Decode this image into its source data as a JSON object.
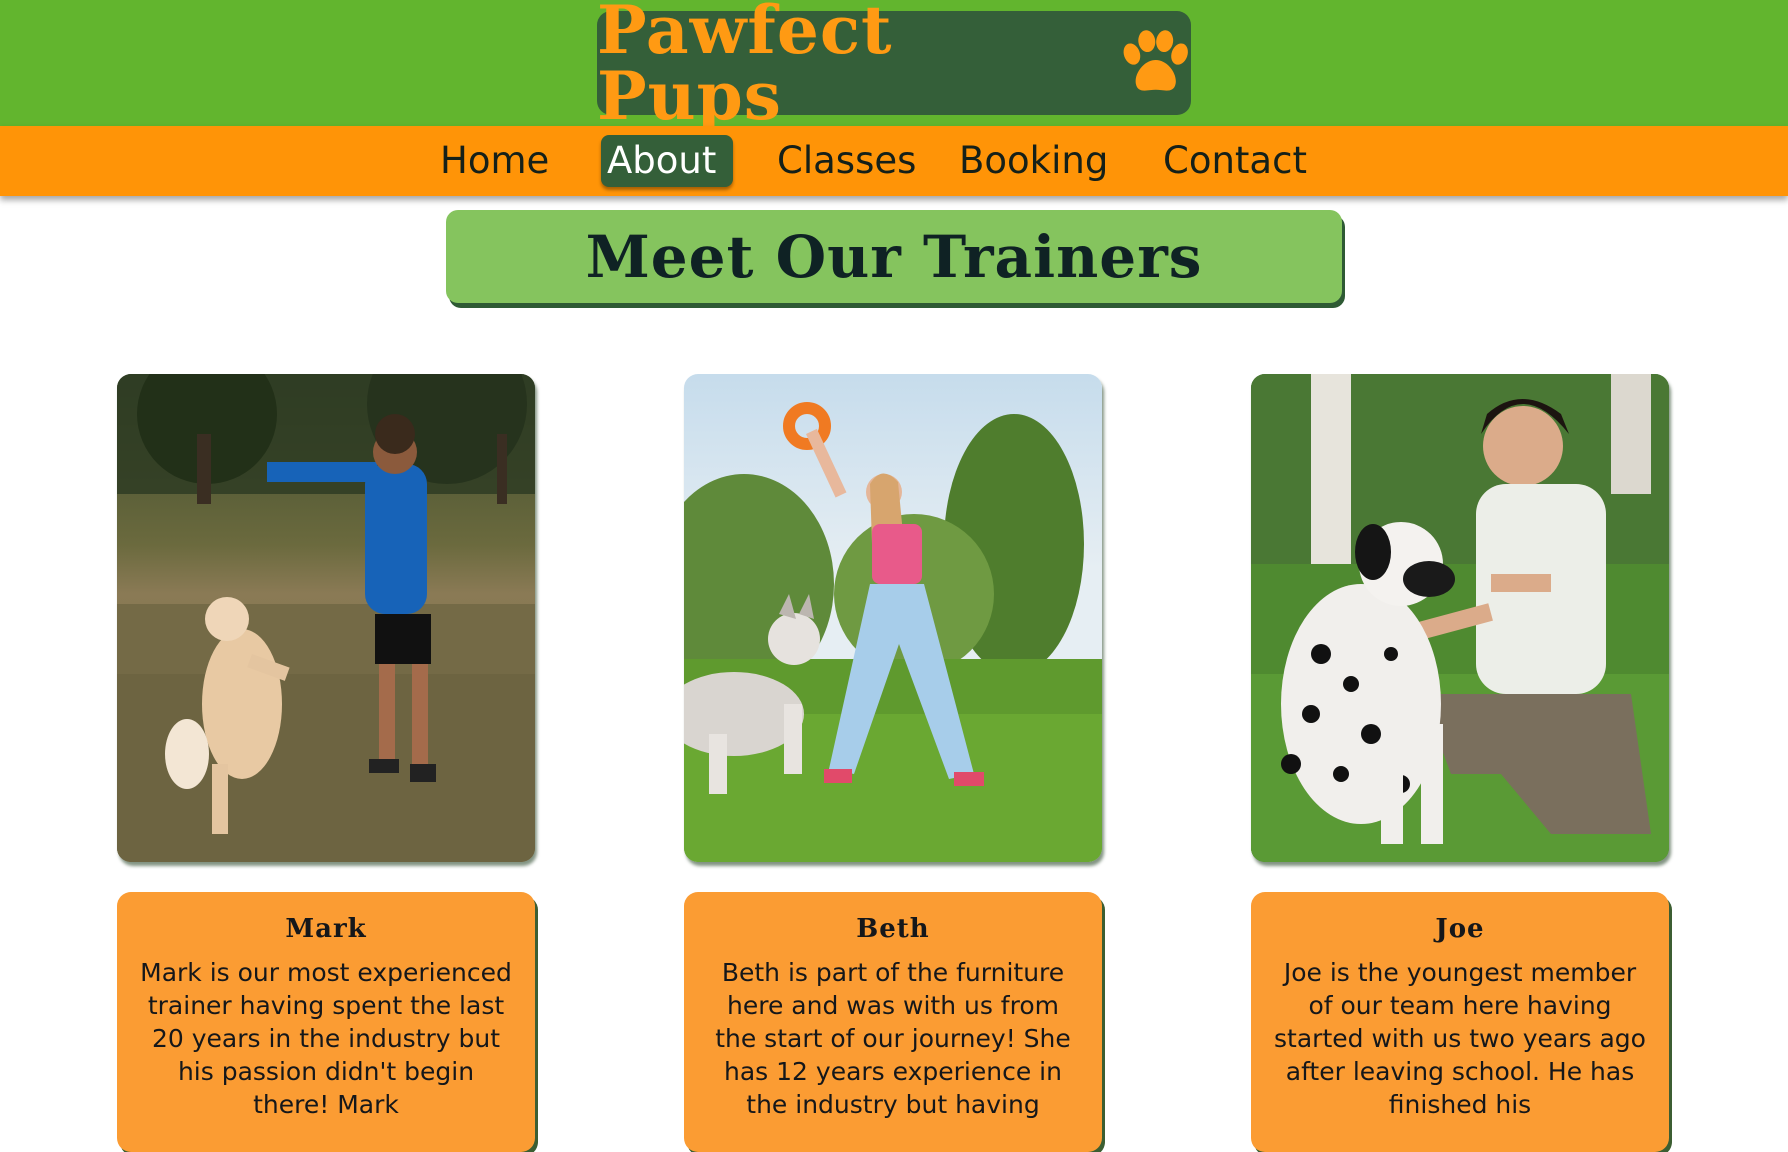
{
  "header": {
    "logo_text": "Pawfect Pups",
    "logo_icon": "paw-icon"
  },
  "nav": {
    "items": [
      {
        "label": "Home"
      },
      {
        "label": "About",
        "active": true
      },
      {
        "label": "Classes"
      },
      {
        "label": "Booking"
      },
      {
        "label": "Contact"
      }
    ]
  },
  "page": {
    "title": "Meet Our Trainers"
  },
  "trainers": [
    {
      "name": "Mark",
      "bio": "Mark is our most experienced trainer having spent the last 20 years in the industry but his passion didn't begin there! Mark"
    },
    {
      "name": "Beth",
      "bio": "Beth is part of the furniture here and was with us from the start of our journey! She has 12 years experience in the industry but having"
    },
    {
      "name": "Joe",
      "bio": "Joe is the youngest member of our team here having started with us two years ago after leaving school. He has finished his"
    }
  ],
  "colors": {
    "header_green": "#62b52e",
    "logo_bg": "#345f39",
    "accent_orange": "#ff9407",
    "title_green": "#85c45e",
    "card_orange": "#fb9c33"
  }
}
